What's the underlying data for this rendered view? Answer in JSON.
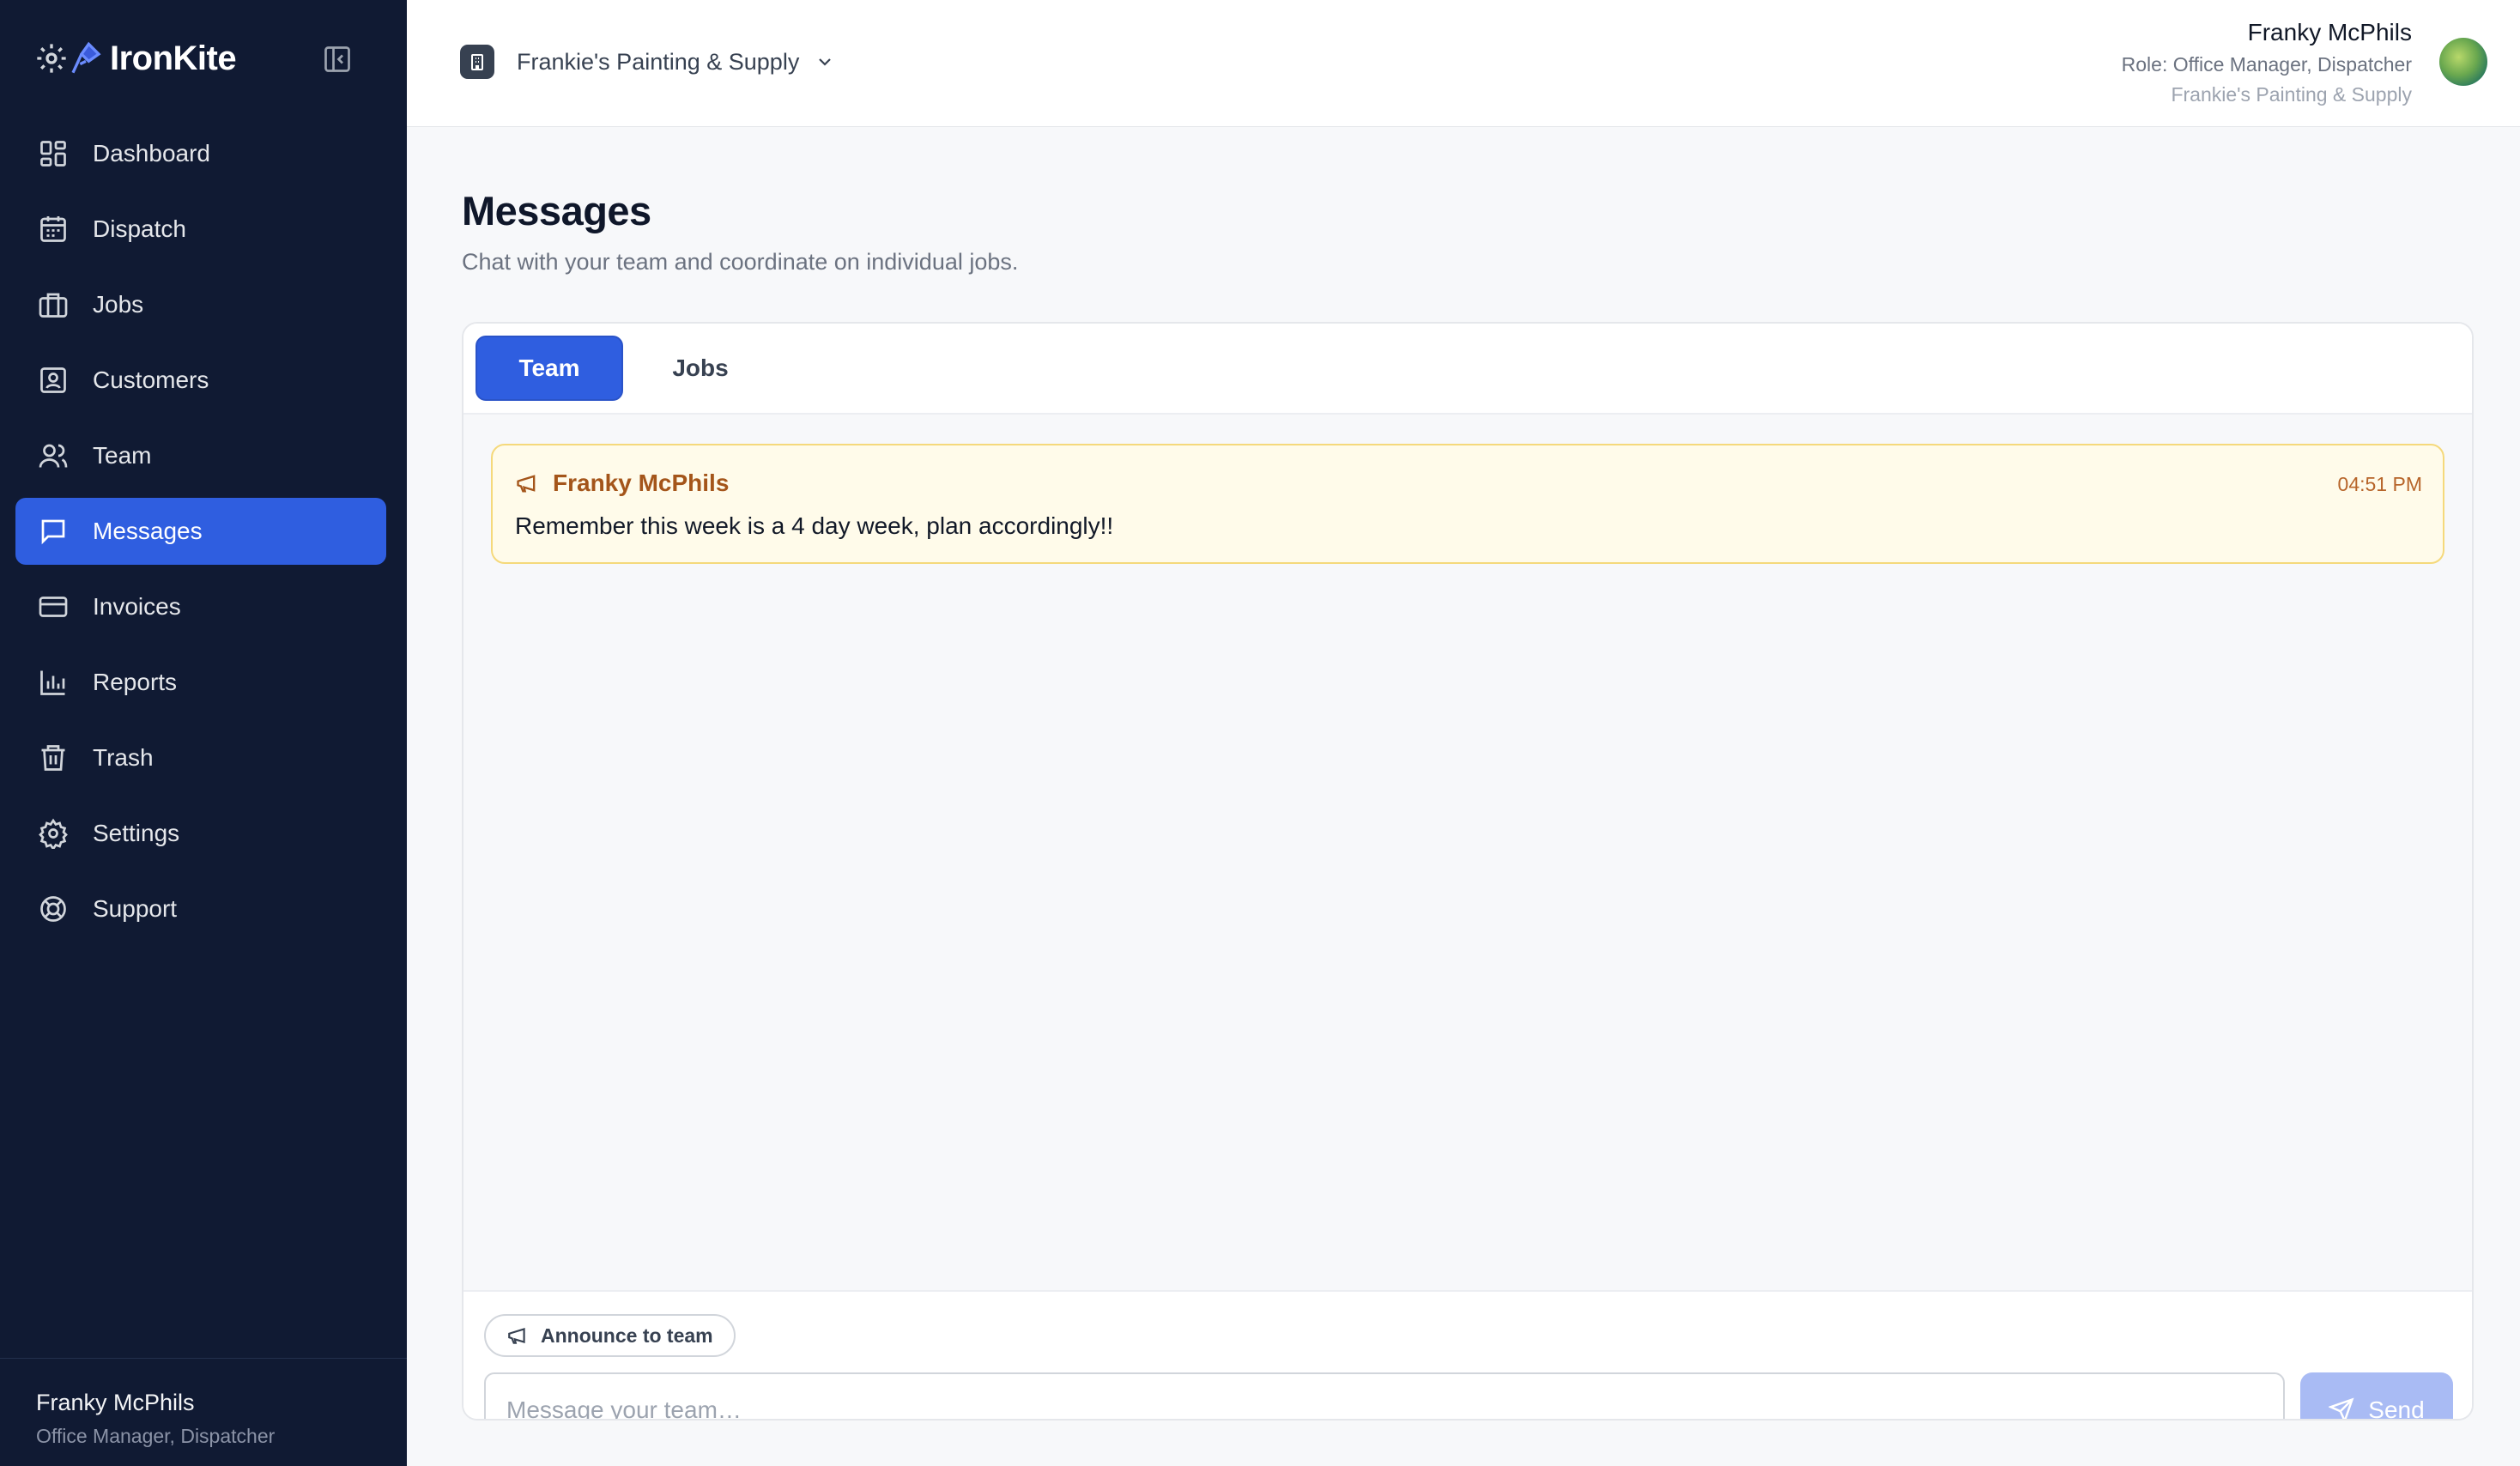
{
  "app": {
    "brand_name": "IronKite",
    "brand_icons": [
      "gear-icon",
      "kite-icon"
    ]
  },
  "sidebar": {
    "items": [
      {
        "label": "Dashboard",
        "icon": "dashboard-icon",
        "active": false
      },
      {
        "label": "Dispatch",
        "icon": "calendar-icon",
        "active": false
      },
      {
        "label": "Jobs",
        "icon": "briefcase-icon",
        "active": false
      },
      {
        "label": "Customers",
        "icon": "contact-card-icon",
        "active": false
      },
      {
        "label": "Team",
        "icon": "users-icon",
        "active": false
      },
      {
        "label": "Messages",
        "icon": "message-icon",
        "active": true
      },
      {
        "label": "Invoices",
        "icon": "credit-card-icon",
        "active": false
      },
      {
        "label": "Reports",
        "icon": "bar-chart-icon",
        "active": false
      },
      {
        "label": "Trash",
        "icon": "trash-icon",
        "active": false
      },
      {
        "label": "Settings",
        "icon": "gear-icon",
        "active": false
      },
      {
        "label": "Support",
        "icon": "lifebuoy-icon",
        "active": false
      }
    ],
    "footer": {
      "user_name": "Franky McPhils",
      "user_role": "Office Manager, Dispatcher"
    }
  },
  "header": {
    "company_name": "Frankie's Painting & Supply",
    "user_name": "Franky McPhils",
    "user_role": "Role: Office Manager, Dispatcher",
    "user_company": "Frankie's Painting & Supply"
  },
  "page": {
    "title": "Messages",
    "subtitle": "Chat with your team and coordinate on individual jobs."
  },
  "tabs": [
    {
      "label": "Team",
      "active": true
    },
    {
      "label": "Jobs",
      "active": false
    }
  ],
  "messages": [
    {
      "author": "Franky McPhils",
      "time": "04:51 PM",
      "text": "Remember this week is a 4 day week, plan accordingly!!",
      "type": "announcement"
    }
  ],
  "composer": {
    "announce_label": "Announce to team",
    "placeholder": "Message your team…",
    "value": "",
    "send_label": "Send"
  },
  "colors": {
    "sidebar_bg": "#101a33",
    "accent": "#2f5ee0",
    "announcement_bg": "#fffbea",
    "announcement_border": "#f5d97b",
    "announcement_text": "#a4551a",
    "send_disabled": "#a9bbf4"
  }
}
